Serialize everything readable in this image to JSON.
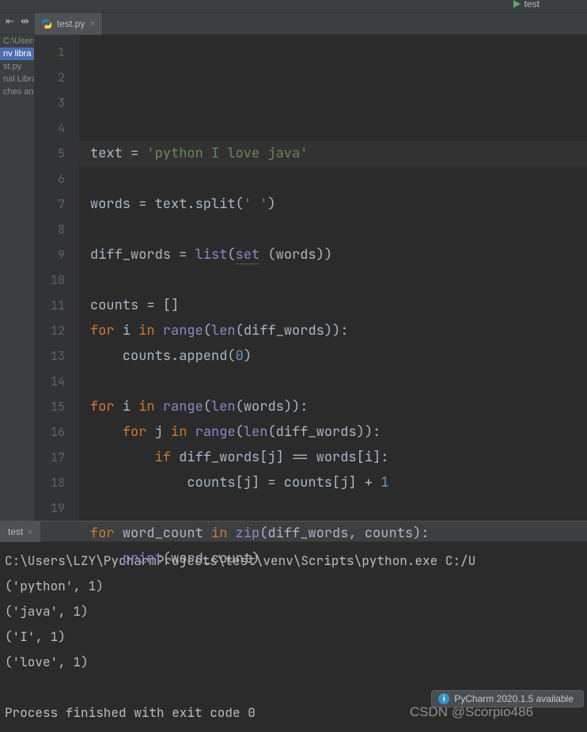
{
  "tab": {
    "icon": "python-file-icon",
    "name": "test.py",
    "close": "×"
  },
  "run_config": {
    "name": "test"
  },
  "sidebar": {
    "items": [
      "C:\\Users",
      "nv  libra",
      "st.py",
      "nal Librar",
      "ches an"
    ]
  },
  "gutter": {
    "start": 1,
    "end": 19
  },
  "code": [
    "",
    [
      [
        "s-def",
        "text "
      ],
      [
        "s-op",
        "= "
      ],
      [
        "s-str",
        "'python I love java'"
      ]
    ],
    "",
    [
      [
        "s-def",
        "words "
      ],
      [
        "s-op",
        "= "
      ],
      [
        "s-def",
        "text.split("
      ],
      [
        "s-str",
        "' '"
      ],
      [
        "s-def",
        ")"
      ]
    ],
    "",
    [
      [
        "s-def",
        "diff_words "
      ],
      [
        "s-op",
        "= "
      ],
      [
        "s-bi",
        "list"
      ],
      [
        "s-def",
        "("
      ],
      [
        "s-set",
        "set"
      ],
      [
        "s-def",
        " (words))"
      ]
    ],
    "",
    [
      [
        "s-def",
        "counts "
      ],
      [
        "s-op",
        "= "
      ],
      [
        "s-def",
        "[]"
      ]
    ],
    [
      [
        "s-kw",
        "for "
      ],
      [
        "s-def",
        "i "
      ],
      [
        "s-kw",
        "in "
      ],
      [
        "s-bi",
        "range"
      ],
      [
        "s-def",
        "("
      ],
      [
        "s-bi",
        "len"
      ],
      [
        "s-def",
        "(diff_words)):"
      ]
    ],
    [
      [
        "s-def",
        "    counts.append("
      ],
      [
        "s-num",
        "0"
      ],
      [
        "s-def",
        ")"
      ]
    ],
    "",
    [
      [
        "s-kw",
        "for "
      ],
      [
        "s-def",
        "i "
      ],
      [
        "s-kw",
        "in "
      ],
      [
        "s-bi",
        "range"
      ],
      [
        "s-def",
        "("
      ],
      [
        "s-bi",
        "len"
      ],
      [
        "s-def",
        "(words)):"
      ]
    ],
    [
      [
        "s-def",
        "    "
      ],
      [
        "s-kw",
        "for "
      ],
      [
        "s-def",
        "j "
      ],
      [
        "s-kw",
        "in "
      ],
      [
        "s-bi",
        "range"
      ],
      [
        "s-def",
        "("
      ],
      [
        "s-bi",
        "len"
      ],
      [
        "s-def",
        "(diff_words)):"
      ]
    ],
    [
      [
        "s-def",
        "        "
      ],
      [
        "s-kw",
        "if "
      ],
      [
        "s-def",
        "diff_words[j] == words[i]:"
      ]
    ],
    [
      [
        "s-def",
        "            counts[j] = counts[j] + "
      ],
      [
        "s-num",
        "1"
      ]
    ],
    "",
    [
      [
        "s-kw",
        "for "
      ],
      [
        "s-def",
        "word_count "
      ],
      [
        "s-kw",
        "in "
      ],
      [
        "s-bi",
        "zip"
      ],
      [
        "s-def",
        "(diff_words"
      ],
      [
        "s-op",
        ","
      ],
      [
        "s-def",
        " counts):"
      ]
    ],
    [
      [
        "s-def",
        "    "
      ],
      [
        "s-bi",
        "print"
      ],
      [
        "s-def",
        "(word_count)"
      ]
    ],
    ""
  ],
  "console_tab": {
    "name": "test",
    "close": "×"
  },
  "console_lines": [
    "C:\\Users\\LZY\\PycharmProjects\\test\\venv\\Scripts\\python.exe C:/U",
    "('python', 1)",
    "('java', 1)",
    "('I', 1)",
    "('love', 1)",
    "",
    "Process finished with exit code 0"
  ],
  "notification": {
    "text": "PyCharm 2020.1.5 available"
  },
  "watermark": "CSDN @Scorpio486"
}
